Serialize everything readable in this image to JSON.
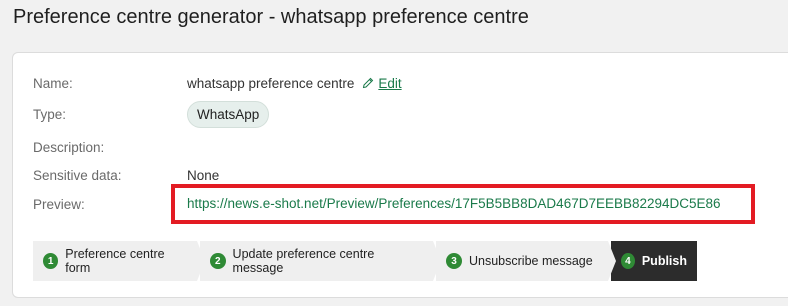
{
  "page": {
    "title": "Preference centre generator - whatsapp preference centre"
  },
  "details": {
    "name_label": "Name:",
    "name_value": "whatsapp preference centre",
    "edit_label": "Edit",
    "type_label": "Type:",
    "type_value": "WhatsApp",
    "description_label": "Description:",
    "description_value": "",
    "sensitive_label": "Sensitive data:",
    "sensitive_value": "None",
    "preview_label": "Preview:",
    "preview_url": "https://news.e-shot.net/Preview/Preferences/17F5B5BB8DAD467D7EEBB82294DC5E86"
  },
  "steps": [
    {
      "number": "1",
      "label": "Preference centre form"
    },
    {
      "number": "2",
      "label": "Update preference centre message"
    },
    {
      "number": "3",
      "label": "Unsubscribe message"
    },
    {
      "number": "4",
      "label": "Publish"
    }
  ],
  "colors": {
    "link": "#1a7a4a",
    "step_badge": "#2f8a35",
    "active_step": "#2c2c2c",
    "highlight_box": "#e31b23"
  },
  "icons": {
    "edit": "pencil-icon"
  }
}
